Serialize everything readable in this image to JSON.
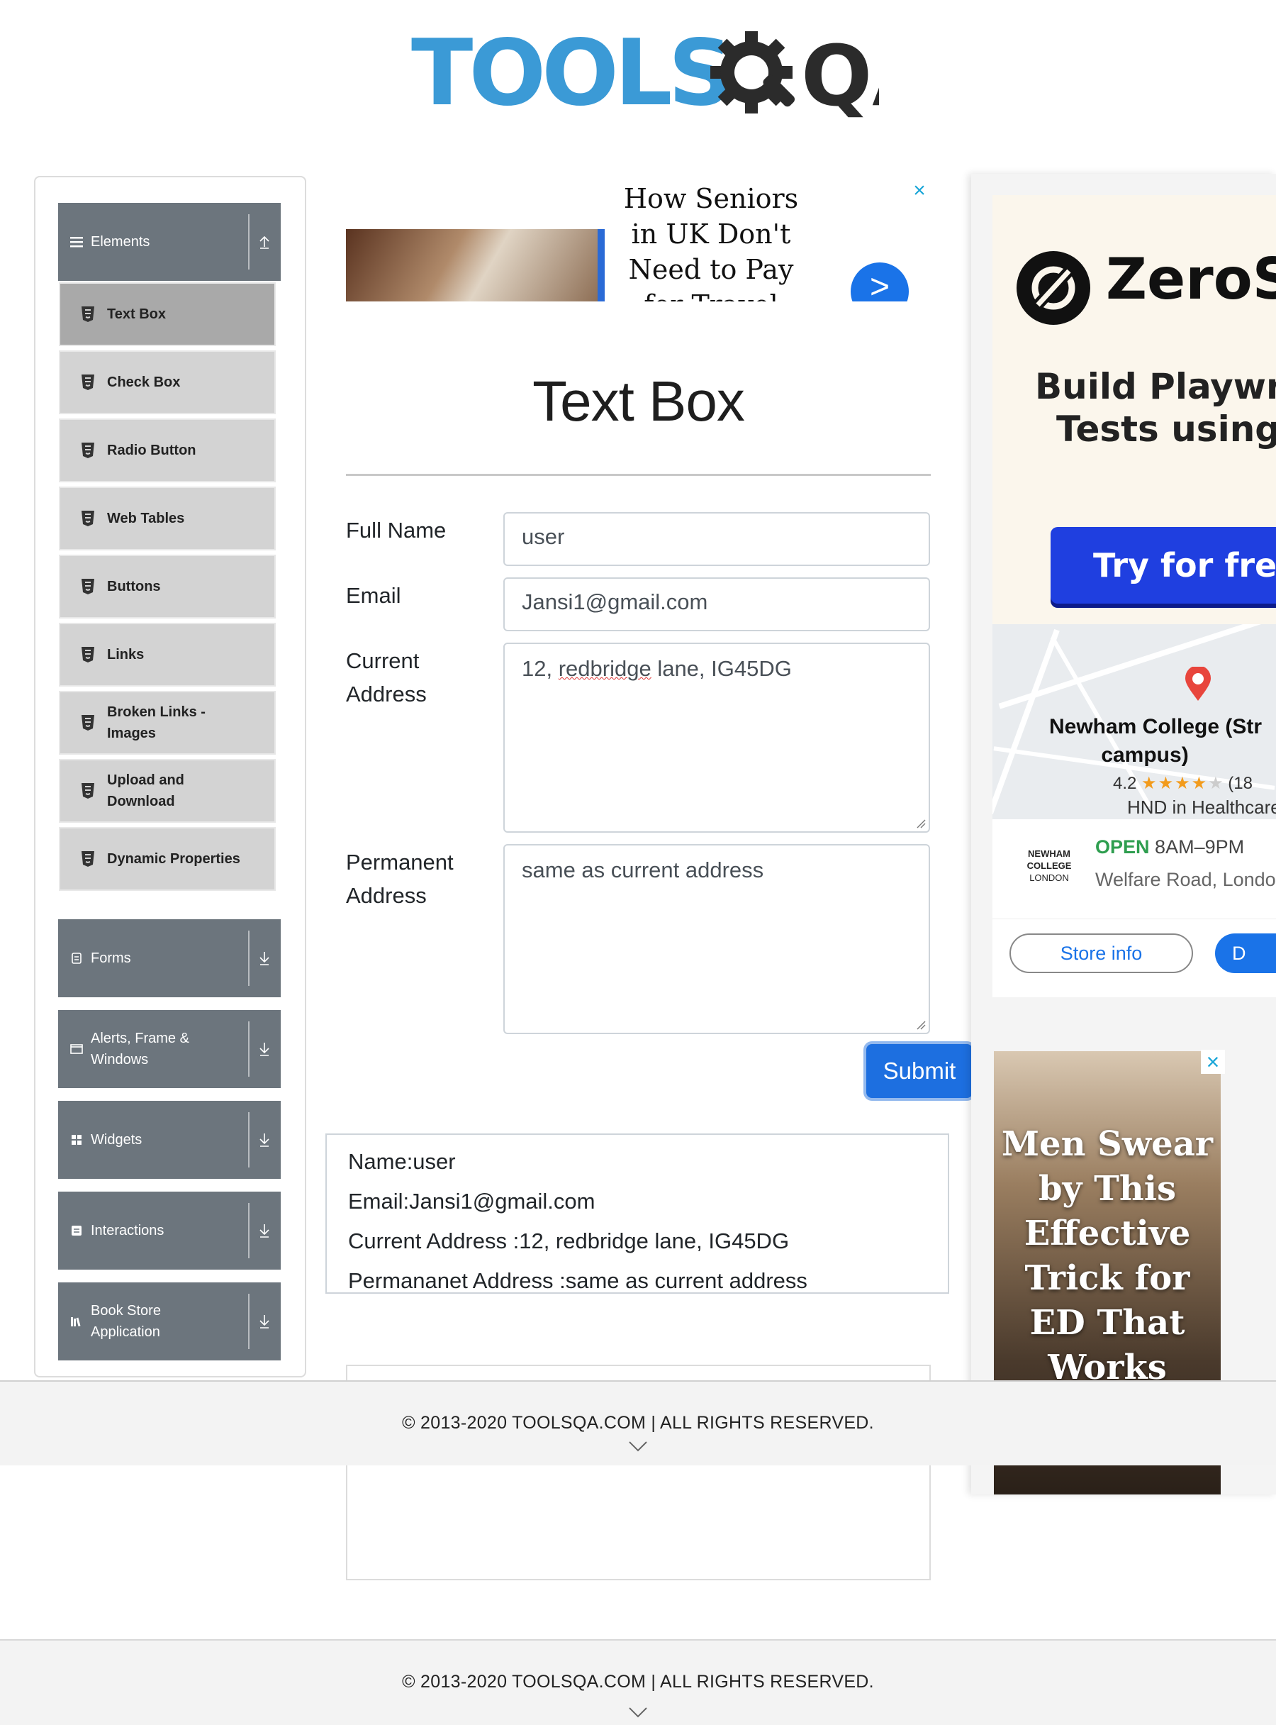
{
  "logo": {
    "text": "TOOLS",
    "suffix": "QA"
  },
  "sidebar": {
    "groups": [
      {
        "label": "Elements",
        "icon": "hamburger-icon",
        "arrow": "collapse-up-icon"
      },
      {
        "label": "Forms",
        "icon": "form-icon",
        "arrow": "expand-down-icon"
      },
      {
        "label": "Alerts, Frame & Windows",
        "icon": "window-icon",
        "arrow": "expand-down-icon"
      },
      {
        "label": "Widgets",
        "icon": "widgets-icon",
        "arrow": "expand-down-icon"
      },
      {
        "label": "Interactions",
        "icon": "interactions-icon",
        "arrow": "expand-down-icon"
      },
      {
        "label": "Book Store Application",
        "icon": "books-icon",
        "arrow": "expand-down-icon"
      }
    ],
    "items": [
      {
        "label": "Text Box",
        "active": true
      },
      {
        "label": "Check Box"
      },
      {
        "label": "Radio Button"
      },
      {
        "label": "Web Tables"
      },
      {
        "label": "Buttons"
      },
      {
        "label": "Links"
      },
      {
        "label": "Broken Links - Images"
      },
      {
        "label": "Upload and Download"
      },
      {
        "label": "Dynamic Properties"
      }
    ]
  },
  "top_ad": {
    "headline": "How Seniors in UK Don't Need to Pay for Travel Insurance",
    "go_glyph": ">",
    "close_glyph": "×"
  },
  "main": {
    "title": "Text Box",
    "form": {
      "full_name_label": "Full Name",
      "full_name_value": "user",
      "email_label": "Email",
      "email_value": "Jansi1@gmail.com",
      "current_address_label": "Current Address",
      "current_address_prefix": "12, ",
      "current_address_misspelled": "redbridge",
      "current_address_suffix": " lane, IG45DG",
      "permanent_address_label": "Permanent Address",
      "permanent_address_value": "same as current address",
      "submit_label": "Submit"
    },
    "output": {
      "name": "Name:user",
      "email": "Email:Jansi1@gmail.com",
      "current_address": "Current Address :12, redbridge lane, IG45DG",
      "permanent_address": "Permananet Address :same as current address"
    }
  },
  "right_ad": {
    "brand": "ZeroS",
    "tagline_1": "Build Playwr",
    "tagline_2": "Tests using",
    "cta": "Try for free",
    "map_place_1": "Newham College (Str",
    "map_place_2": "campus)",
    "rating": "4.2",
    "stars": "★★★★",
    "star_empty": "★",
    "rating_count": "(18",
    "category": "HND in Healthcare",
    "biz_logo_1": "NEWHAM",
    "biz_logo_2": "COLLEGE",
    "biz_logo_3": "LONDON",
    "open_label": "OPEN",
    "hours": "8AM–9PM",
    "address": "Welfare Road, London",
    "store_info": "Store info",
    "directions": "D",
    "ed_ad_text": "Men Swear by This Effective Trick for ED That Works Overnight",
    "ed_close": "×"
  },
  "footer": {
    "copyright": "© 2013-2020 TOOLSQA.COM | ALL RIGHTS RESERVED."
  }
}
